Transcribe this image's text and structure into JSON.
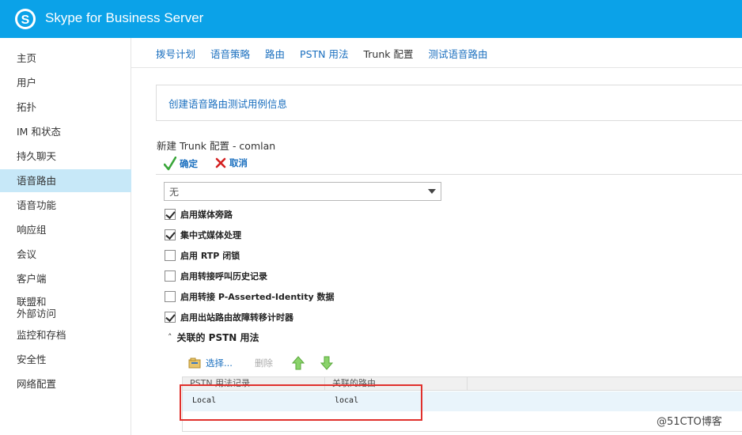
{
  "header": {
    "title": "Skype for Business Server"
  },
  "sidebar": {
    "items": [
      {
        "label": "主页"
      },
      {
        "label": "用户"
      },
      {
        "label": "拓扑"
      },
      {
        "label": "IM 和状态"
      },
      {
        "label": "持久聊天"
      },
      {
        "label": "语音路由",
        "active": true
      },
      {
        "label": "语音功能"
      },
      {
        "label": "响应组"
      },
      {
        "label": "会议"
      },
      {
        "label": "客户端"
      },
      {
        "label": "联盟和\n外部访问"
      },
      {
        "label": "监控和存档"
      },
      {
        "label": "安全性"
      },
      {
        "label": "网络配置"
      }
    ]
  },
  "tabs": [
    {
      "label": "拨号计划"
    },
    {
      "label": "语音策略"
    },
    {
      "label": "路由"
    },
    {
      "label": "PSTN 用法"
    },
    {
      "label": "Trunk 配置",
      "active": true
    },
    {
      "label": "测试语音路由"
    }
  ],
  "info": {
    "link": "创建语音路由测试用例信息"
  },
  "form": {
    "title": "新建 Trunk 配置 - comlan",
    "ok_label": "确定",
    "cancel_label": "取消",
    "select_value": "无",
    "checkboxes": [
      {
        "label": "启用媒体旁路",
        "checked": true
      },
      {
        "label": "集中式媒体处理",
        "checked": true
      },
      {
        "label": "启用 RTP 闭锁",
        "checked": false
      },
      {
        "label": "启用转接呼叫历史记录",
        "checked": false
      },
      {
        "label": "启用转接 P-Asserted-Identity 数据",
        "checked": false
      },
      {
        "label": "启用出站路由故障转移计时器",
        "checked": true
      }
    ],
    "section_label": "关联的 PSTN 用法",
    "toolbar": {
      "select_label": "选择...",
      "delete_label": "删除"
    },
    "grid": {
      "columns": [
        "PSTN 用法记录",
        "关联的路由"
      ],
      "rows": [
        {
          "usage": "Local",
          "route": "local"
        }
      ]
    }
  },
  "watermark": "@51CTO博客",
  "colors": {
    "header": "#0ba2e8",
    "link": "#1a6fbf",
    "active_nav": "#c7e8f8",
    "highlight": "#e0302c"
  }
}
